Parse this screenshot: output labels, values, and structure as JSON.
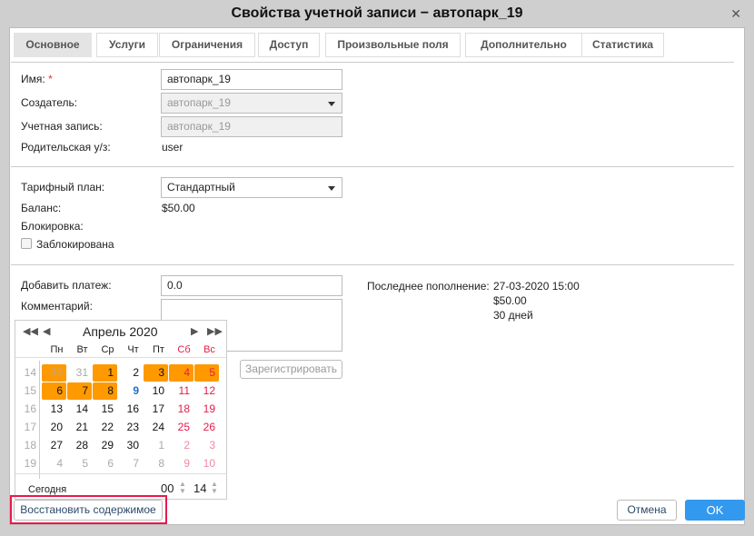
{
  "title": "Свойства учетной записи − автопарк_19",
  "tabs": [
    "Основное",
    "Услуги",
    "Ограничения",
    "Доступ",
    "Произвольные поля",
    "Дополнительно",
    "Статистика"
  ],
  "form": {
    "name_label": "Имя:",
    "required_mark": "*",
    "name_value": "автопарк_19",
    "creator_label": "Создатель:",
    "creator_value": "автопарк_19",
    "account_label": "Учетная запись:",
    "account_value": "автопарк_19",
    "parent_label": "Родительская у/з:",
    "parent_value": "user",
    "tariff_label": "Тарифный план:",
    "tariff_value": "Стандартный",
    "balance_label": "Баланс:",
    "balance_value": "$50.00",
    "block_label": "Блокировка:",
    "blocked_checkbox": "Заблокирована",
    "blocked": false,
    "payment_label": "Добавить платеж:",
    "payment_value": "0.0",
    "comment_label": "Комментарий:",
    "register_button": "Зарегистрировать",
    "last_topup_label": "Последнее пополнение:",
    "last_topup_date": "27-03-2020 15:00",
    "last_topup_amount": "$50.00",
    "last_topup_period": "30 дней"
  },
  "calendar": {
    "month": "Апрель 2020",
    "weekdays": [
      "Пн",
      "Вт",
      "Ср",
      "Чт",
      "Пт",
      "Сб",
      "Вс"
    ],
    "weeks": [
      {
        "n": "14",
        "days": [
          "30",
          "31",
          "1",
          "2",
          "3",
          "4",
          "5"
        ]
      },
      {
        "n": "15",
        "days": [
          "6",
          "7",
          "8",
          "9",
          "10",
          "11",
          "12"
        ]
      },
      {
        "n": "16",
        "days": [
          "13",
          "14",
          "15",
          "16",
          "17",
          "18",
          "19"
        ]
      },
      {
        "n": "17",
        "days": [
          "20",
          "21",
          "22",
          "23",
          "24",
          "25",
          "26"
        ]
      },
      {
        "n": "18",
        "days": [
          "27",
          "28",
          "29",
          "30",
          "1",
          "2",
          "3"
        ]
      },
      {
        "n": "19",
        "days": [
          "4",
          "5",
          "6",
          "7",
          "8",
          "9",
          "10"
        ]
      }
    ],
    "highlighted": [
      "0-0",
      "0-2",
      "0-4",
      "0-5",
      "0-6",
      "1-0",
      "1-1",
      "1-2"
    ],
    "today": "1-3",
    "today_label": "Сегодня",
    "hour": "00",
    "minute": "14",
    "colors": {
      "highlight": "#ff9900",
      "weekend": "#e8194a",
      "today": "#1a6fc9"
    }
  },
  "footer": {
    "restore": "Восстановить содержимое",
    "cancel": "Отмена",
    "ok": "OK"
  }
}
